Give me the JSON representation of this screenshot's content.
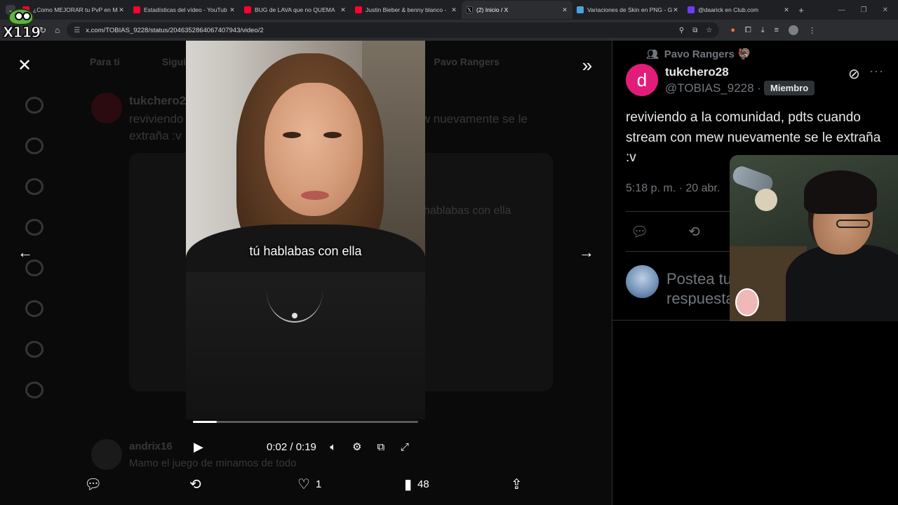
{
  "browser": {
    "tabs": [
      {
        "title": "¿Como MEJORAR tu PvP en Mi",
        "favicon_color": "#ff0033",
        "active": false
      },
      {
        "title": "Estadísticas del vídeo - YouTub",
        "favicon_color": "#ff0033",
        "active": false
      },
      {
        "title": "BUG de LAVA que no QUEMA",
        "favicon_color": "#ff0033",
        "active": false
      },
      {
        "title": "Justin Bieber & benny blanco -",
        "favicon_color": "#ff0033",
        "active": false
      },
      {
        "title": "(2) Inicio / X",
        "favicon_color": "#ffffff",
        "active": true
      },
      {
        "title": "Variaciones de Skin en PNG - G",
        "favicon_color": "#4aa3df",
        "active": false
      },
      {
        "title": "@daarick en Club.com",
        "favicon_color": "#6b3cff",
        "active": false
      }
    ],
    "url": "x.com/TOBIAS_9228/status/2046352864067407943/video/2"
  },
  "logo": {
    "text": "X119"
  },
  "viewer": {
    "background_page": {
      "tabs": [
        "Para ti",
        "Siguiendo",
        "Pavo Rangers"
      ],
      "post_author": "tukchero28",
      "post_text": "reviviendo a la comunidad, pdts cuando stream con mew nuevamente se le extraña :v",
      "media_caption": "hablabas con ella",
      "reply_author": "andrix16",
      "reply_text": "Mamo el juego de minamos de todo"
    },
    "subtitle": "tú hablabas con ella",
    "progress_percent": 10.5,
    "current_time": "0:02",
    "duration": "0:19",
    "time_label": "0:02 / 0:19",
    "actions": {
      "likes": "1",
      "views": "48"
    }
  },
  "post": {
    "community": "Pavo Rangers 🦃",
    "avatar_letter": "d",
    "avatar_color": "#e21d79",
    "author_name": "tukchero28",
    "author_handle": "@TOBIAS_9228 ·",
    "badge": "Miembro",
    "text": "reviviendo a la comunidad, pdts cuando stream con  mew nuevamente se le extraña :v",
    "timestamp": "5:18 p. m. · 20 abr.",
    "reply_placeholder": "Postea tu respuesta"
  },
  "colors": {
    "background": "#000000",
    "muted_text": "#71767b",
    "divider": "#2f3336",
    "text": "#e7e9ea"
  }
}
